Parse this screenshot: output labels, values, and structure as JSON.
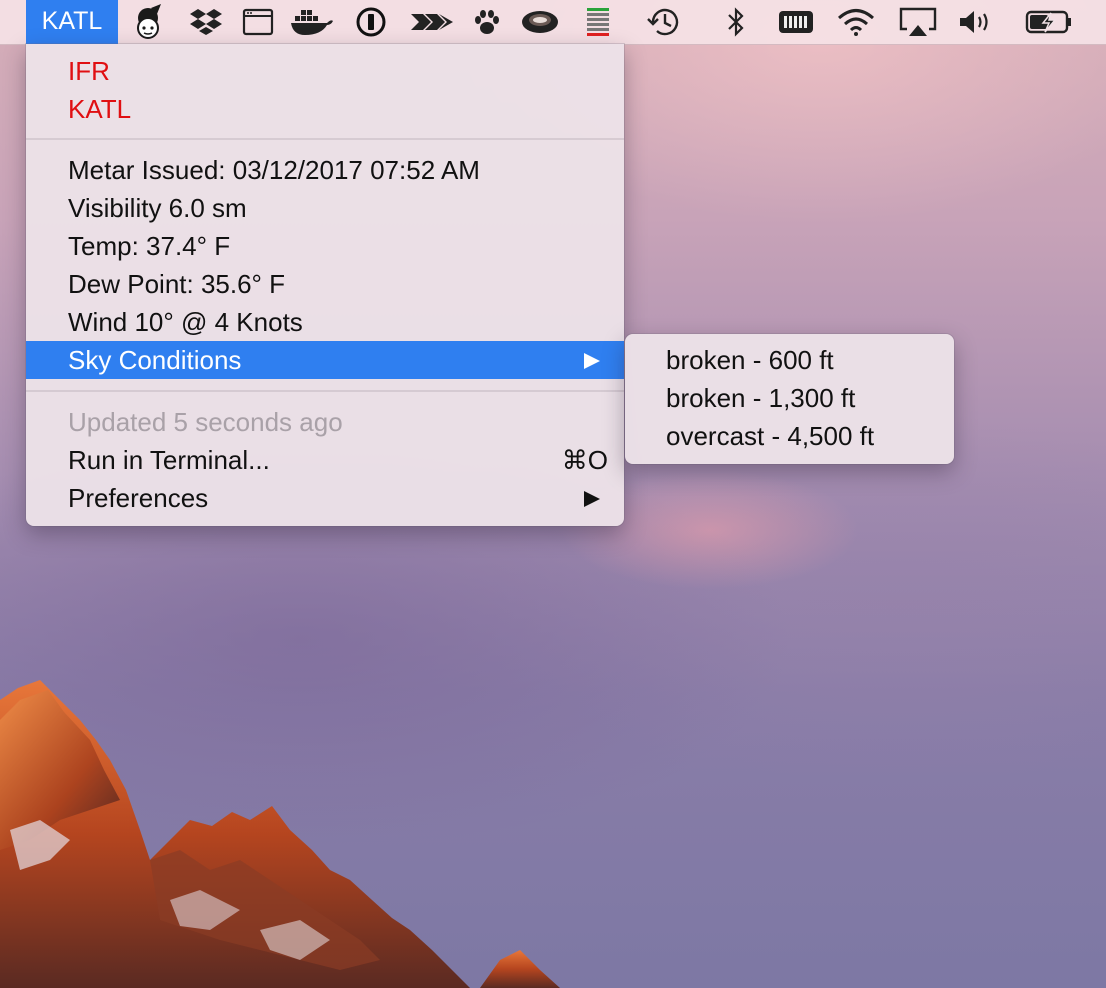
{
  "menubar": {
    "app_title": "KATL",
    "status_icons": [
      "character-icon",
      "dropbox-icon",
      "window-icon",
      "docker-icon",
      "onepassword-icon",
      "arrow-icon",
      "paw-icon",
      "coffee-cup-icon",
      "stack-meter-icon",
      "time-machine-icon",
      "bluetooth-icon",
      "battery-indicator-icon",
      "wifi-icon",
      "airplay-icon",
      "volume-icon",
      "battery-charging-icon"
    ]
  },
  "menu": {
    "flight_category": "IFR",
    "station": "KATL",
    "metar_issued": "Metar Issued: 03/12/2017 07:52 AM",
    "visibility": "Visibility 6.0 sm",
    "temp": "Temp: 37.4° F",
    "dew_point": "Dew Point: 35.6° F",
    "wind": "Wind 10° @ 4 Knots",
    "sky_conditions": "Sky Conditions",
    "updated": "Updated 5 seconds ago",
    "run_in_terminal": "Run in Terminal...",
    "run_in_terminal_shortcut": "⌘O",
    "preferences": "Preferences"
  },
  "submenu": {
    "items": [
      "broken - 600 ft",
      "broken - 1,300 ft",
      "overcast - 4,500 ft"
    ]
  },
  "colors": {
    "highlight": "#2f7ff0",
    "flight_category_red": "#e00f12"
  }
}
